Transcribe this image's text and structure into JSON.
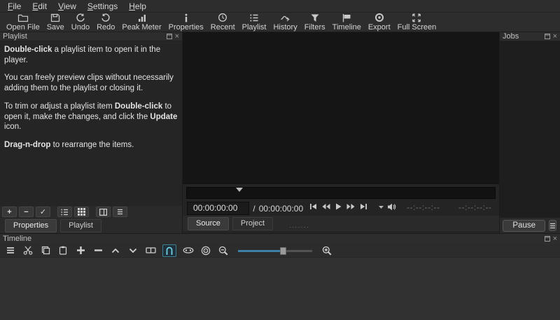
{
  "menu_bar": {
    "items": [
      "File",
      "Edit",
      "View",
      "Settings",
      "Help"
    ]
  },
  "toolbar": {
    "items": [
      {
        "label": "Open File",
        "icon": "folder-icon"
      },
      {
        "label": "Save",
        "icon": "floppy-icon"
      },
      {
        "label": "Undo",
        "icon": "undo-arrow-icon"
      },
      {
        "label": "Redo",
        "icon": "redo-arrow-icon"
      },
      {
        "label": "Peak Meter",
        "icon": "bar-meter-icon"
      },
      {
        "label": "Properties",
        "icon": "info-icon"
      },
      {
        "label": "Recent",
        "icon": "clock-icon"
      },
      {
        "label": "Playlist",
        "icon": "list-icon"
      },
      {
        "label": "History",
        "icon": "history-arrow-icon"
      },
      {
        "label": "Filters",
        "icon": "funnel-icon"
      },
      {
        "label": "Timeline",
        "icon": "flag-icon"
      },
      {
        "label": "Export",
        "icon": "record-circle-icon"
      },
      {
        "label": "Full Screen",
        "icon": "expand-arrows-icon"
      }
    ]
  },
  "panels": {
    "playlist": {
      "title": "Playlist",
      "tips": [
        {
          "segments": [
            {
              "t": "Double-click",
              "b": true
            },
            {
              "t": " a playlist item to open it in the player.",
              "b": false
            }
          ]
        },
        {
          "segments": [
            {
              "t": "You can freely preview clips without necessarily adding them to the playlist or closing it.",
              "b": false
            }
          ]
        },
        {
          "segments": [
            {
              "t": "To trim or adjust a playlist item ",
              "b": false
            },
            {
              "t": "Double-click",
              "b": true
            },
            {
              "t": " to open it, make the changes, and click the ",
              "b": false
            },
            {
              "t": "Update",
              "b": true
            },
            {
              "t": " icon.",
              "b": false
            }
          ]
        },
        {
          "segments": [
            {
              "t": "Drag-n-drop",
              "b": true
            },
            {
              "t": " to rearrange the items.",
              "b": false
            }
          ]
        }
      ],
      "toolbar_icons": [
        "plus-icon",
        "minus-icon",
        "check-icon",
        "view-list-icon",
        "view-tiles-icon",
        "view-details-icon",
        "hamburger-menu-icon"
      ],
      "add_label": "+",
      "remove_label": "−",
      "update_label": "✓",
      "tabs": [
        "Properties",
        "Playlist"
      ]
    },
    "player": {
      "position": "00:00:00:00",
      "duration_separator": "/",
      "duration": "00:00:00:00",
      "in_point": "--:--:--:--",
      "selected_duration": "--:--:--:--",
      "playhead_position_pct": 17,
      "transport_icons": [
        "skip-to-start-icon",
        "rewind-icon",
        "play-icon",
        "fast-forward-icon",
        "skip-to-end-icon",
        "caret-down-icon",
        "volume-icon"
      ],
      "tabs": [
        "Source",
        "Project"
      ]
    },
    "jobs": {
      "title": "Jobs",
      "pause_label": "Pause",
      "menu_icon": "hamburger-menu-icon"
    }
  },
  "timeline": {
    "title": "Timeline",
    "tools": [
      "timeline-menu",
      "cut",
      "copy",
      "paste",
      "append",
      "ripple-delete",
      "lift",
      "overwrite",
      "clip-strip",
      "snap",
      "scrub-while-dragging",
      "ripple-all-tracks",
      "zoom-out",
      "zoom-slider",
      "zoom-in"
    ],
    "snap_active": true,
    "zoom_slider_pct": 60
  },
  "colors": {
    "window_bg": "#2d2d2d",
    "player_bg": "#151515",
    "accent_active": "#6fd3e8",
    "slider_fill": "#3f7fa6"
  }
}
